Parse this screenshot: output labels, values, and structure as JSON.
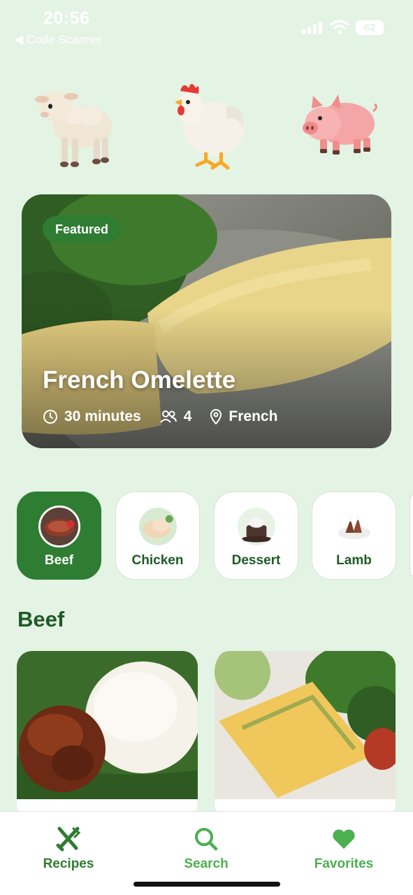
{
  "status_bar": {
    "time": "20:56",
    "back_app": "◀ Code Scanner",
    "battery": "62"
  },
  "animals": [
    "sheep-icon",
    "chicken-icon",
    "pig-icon"
  ],
  "featured": {
    "badge": "Featured",
    "title": "French Omelette",
    "time": "30 minutes",
    "servings": "4",
    "cuisine": "French"
  },
  "categories": [
    {
      "label": "Beef",
      "active": true
    },
    {
      "label": "Chicken",
      "active": false
    },
    {
      "label": "Dessert",
      "active": false
    },
    {
      "label": "Lamb",
      "active": false
    }
  ],
  "section": {
    "title": "Beef"
  },
  "recipes": [
    {
      "image": "beef-rice-dish-image"
    },
    {
      "image": "omelette-slice-image"
    }
  ],
  "nav": {
    "recipes": "Recipes",
    "search": "Search",
    "favorites": "Favorites"
  },
  "colors": {
    "background": "#e3f3e4",
    "primary": "#2e7d32",
    "accent": "#4caf50"
  }
}
